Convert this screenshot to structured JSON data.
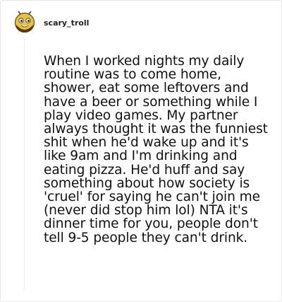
{
  "comment": {
    "username": "scary_troll",
    "avatar_icon": "bee-mascot-icon",
    "text": "When I worked nights my daily routine was to come home, shower, eat some leftovers and have a beer or something while I play video games. My partner always thought it was the funniest shit when he'd wake up and it's like 9am and I'm drinking and eating pizza. He'd huff and say something about how society is 'cruel' for saying he can't join me (never did stop him lol) NTA it's dinner time for you, people don't tell 9-5 people they can't drink."
  }
}
